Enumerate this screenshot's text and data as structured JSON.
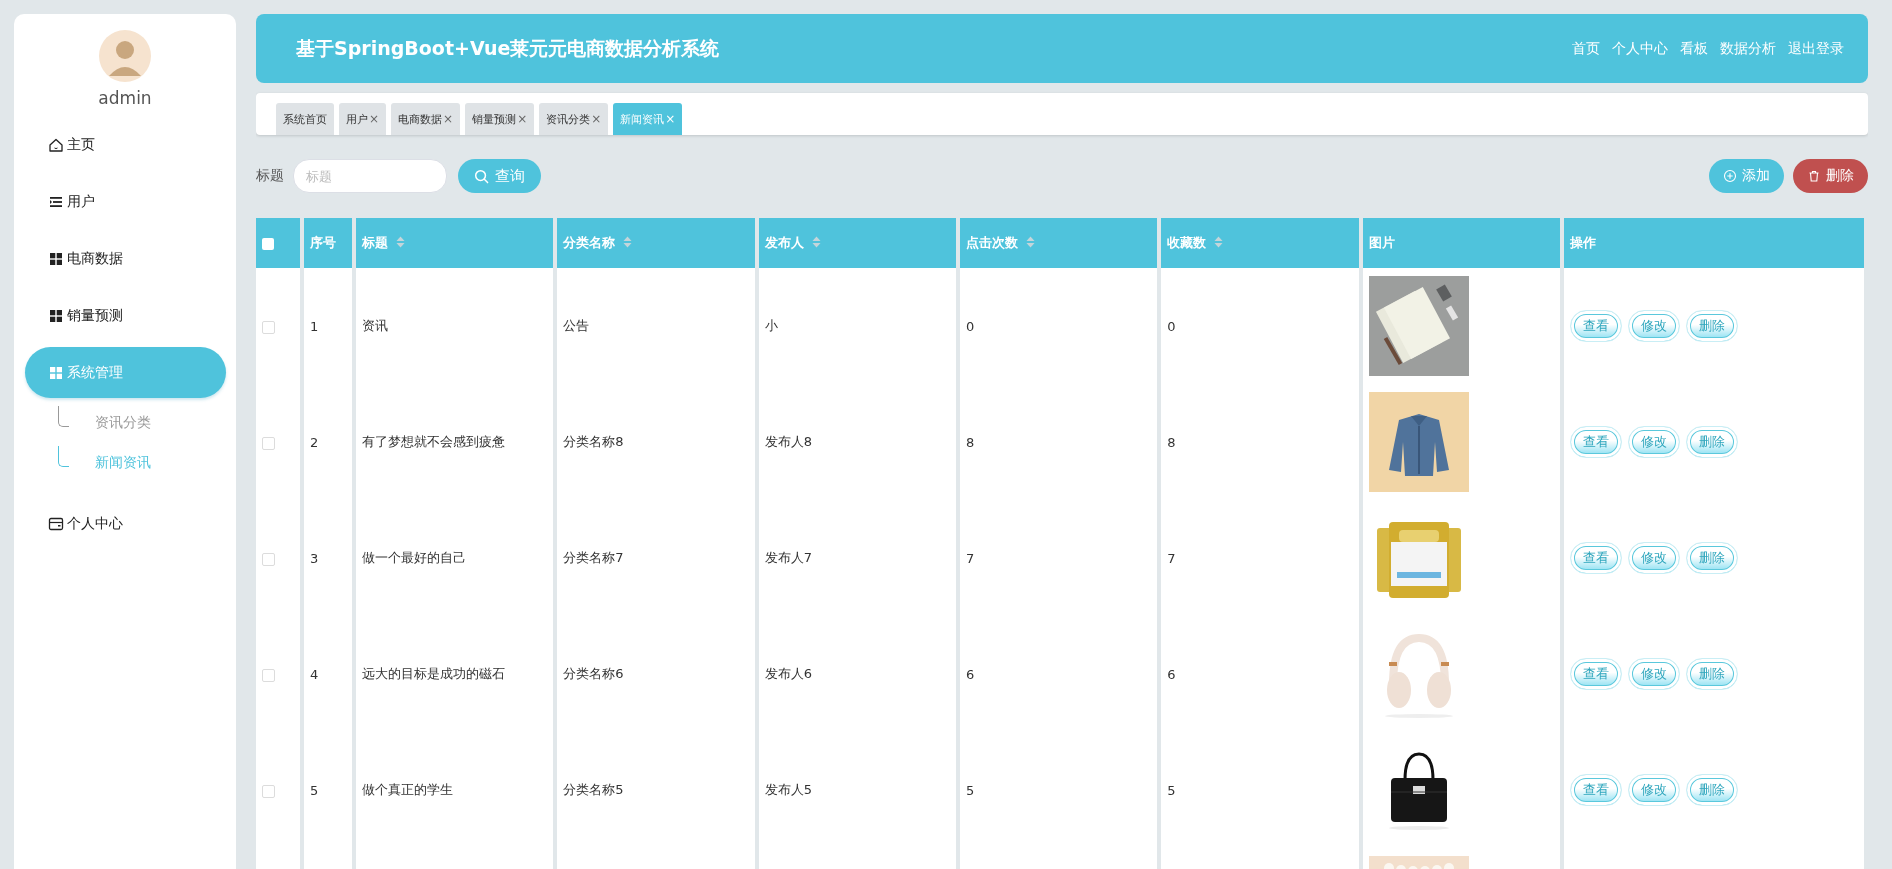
{
  "sidebar": {
    "user": {
      "name": "admin"
    },
    "items": [
      {
        "label": "主页",
        "kind": "home",
        "selected": false
      },
      {
        "label": "用户",
        "kind": "list",
        "selected": false
      },
      {
        "label": "电商数据",
        "kind": "grid",
        "selected": false
      },
      {
        "label": "销量预测",
        "kind": "grid",
        "selected": false
      },
      {
        "label": "系统管理",
        "kind": "grid",
        "selected": true,
        "expanded": true,
        "children": [
          {
            "label": "资讯分类",
            "selected": false
          },
          {
            "label": "新闻资讯",
            "selected": true
          }
        ]
      },
      {
        "label": "个人中心",
        "kind": "card",
        "selected": false
      }
    ]
  },
  "header": {
    "title": "基于SpringBoot+Vue莱元元电商数据分析系统",
    "nav": [
      "首页",
      "个人中心",
      "看板",
      "数据分析",
      "退出登录"
    ]
  },
  "tabs": [
    {
      "label": "系统首页",
      "selected": false
    },
    {
      "label": "用户",
      "close": "×",
      "selected": false
    },
    {
      "label": "电商数据",
      "close": "×",
      "selected": false
    },
    {
      "label": "销量预测",
      "close": "×",
      "selected": false
    },
    {
      "label": "资讯分类",
      "close": "×",
      "selected": false
    },
    {
      "label": "新闻资讯",
      "close": "×",
      "selected": true
    }
  ],
  "search": {
    "label": "标题",
    "placeholder": "标题",
    "button": "查询"
  },
  "actions": [
    {
      "label": "添加",
      "kind": "add"
    },
    {
      "label": "删除",
      "kind": "delete"
    }
  ],
  "table": {
    "columns": [
      {
        "kind": "checkbox",
        "checked": false
      },
      {
        "label": "序号",
        "sortable": false
      },
      {
        "label": "标题",
        "sortable": true
      },
      {
        "label": "分类名称",
        "sortable": true
      },
      {
        "label": "发布人",
        "sortable": true
      },
      {
        "label": "点击次数",
        "sortable": true
      },
      {
        "label": "收藏数",
        "sortable": true
      },
      {
        "label": "图片",
        "sortable": false
      },
      {
        "label": "操作",
        "sortable": false
      }
    ],
    "rows": [
      {
        "checked": false,
        "cells": [
          "1",
          "资讯",
          "公告",
          "小",
          "0",
          "0"
        ],
        "image": {
          "kind": "picture"
        },
        "actions": [
          "查看",
          "修改",
          "删除"
        ]
      },
      {
        "checked": false,
        "cells": [
          "2",
          "有了梦想就不会感到疲惫",
          "分类名称8",
          "发布人8",
          "8",
          "8"
        ],
        "image": {
          "kind": "picture"
        },
        "actions": [
          "查看",
          "修改",
          "删除"
        ]
      },
      {
        "checked": false,
        "cells": [
          "3",
          "做一个最好的自己",
          "分类名称7",
          "发布人7",
          "7",
          "7"
        ],
        "image": {
          "kind": "picture"
        },
        "actions": [
          "查看",
          "修改",
          "删除"
        ]
      },
      {
        "checked": false,
        "cells": [
          "4",
          "远大的目标是成功的磁石",
          "分类名称6",
          "发布人6",
          "6",
          "6"
        ],
        "image": {
          "kind": "picture"
        },
        "actions": [
          "查看",
          "修改",
          "删除"
        ]
      },
      {
        "checked": false,
        "cells": [
          "5",
          "做个真正的学生",
          "分类名称5",
          "发布人5",
          "5",
          "5"
        ],
        "image": {
          "kind": "picture"
        },
        "actions": [
          "查看",
          "修改",
          "删除"
        ]
      },
      {
        "image": {
          "kind": "picture"
        }
      }
    ]
  }
}
